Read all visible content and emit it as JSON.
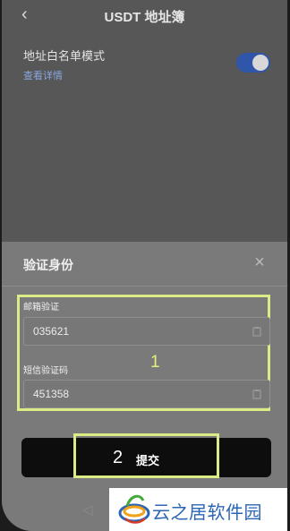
{
  "header": {
    "back_glyph": "‹",
    "title": "USDT 地址簿"
  },
  "settings": {
    "whitelist_label": "地址白名单模式",
    "view_details": "查看详情",
    "whitelist_enabled": true
  },
  "dialog": {
    "title": "验证身份",
    "close_glyph": "×",
    "email": {
      "label": "邮箱验证",
      "value": "035621"
    },
    "sms": {
      "label": "短信验证码",
      "value": "451358"
    },
    "submit_label": "提交"
  },
  "annotations": {
    "step1": "1",
    "step2": "2"
  },
  "nav": {
    "back_glyph": "◁"
  },
  "watermark": {
    "text": "云之居软件园"
  },
  "colors": {
    "accent_toggle": "#2f56a8",
    "annotation": "#d9ec86",
    "link": "#8aa6e0",
    "watermark": "#2b65b4"
  }
}
